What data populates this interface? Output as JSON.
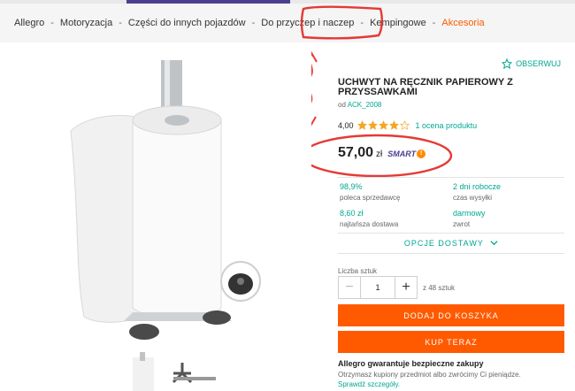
{
  "colors": {
    "accent": "#ff5a00",
    "teal": "#00a790",
    "brand": "#4a3f8f",
    "annotation": "#e53935"
  },
  "breadcrumb": [
    "Allegro",
    "Motoryzacja",
    "Części do innych pojazdów",
    "Do przyczep i naczep",
    "Kempingowe",
    "Akcesoria"
  ],
  "product": {
    "watch_label": "OBSERWUJ",
    "watch_icon": "star-outline-icon",
    "title": "UCHWYT NA RĘCZNIK PAPIEROWY Z PRZYSSAWKAMI",
    "seller_prefix": "od",
    "seller": "ACK_2008",
    "rating_value": "4,00",
    "stars_filled": 4,
    "stars_total": 5,
    "reviews": "1 ocena produktu",
    "price_amount": "57,00",
    "price_currency": "zł",
    "smart_label": "SMART",
    "smart_badge": "!"
  },
  "stats": [
    {
      "value": "98,9%",
      "label": "poleca sprzedawcę"
    },
    {
      "value": "2 dni robocze",
      "label": "czas wysyłki"
    },
    {
      "value": "8,60 zł",
      "label": "najtańsza dostawa"
    },
    {
      "value": "darmowy",
      "label": "zwrot"
    }
  ],
  "delivery_options": "OPCJE DOSTAWY",
  "quantity": {
    "label": "Liczba sztuk",
    "value": "1",
    "of": "z 48 sztuk"
  },
  "buttons": {
    "add_to_cart": "DODAJ DO KOSZYKA",
    "buy_now": "KUP TERAZ"
  },
  "guarantee": {
    "title": "Allegro gwarantuje bezpieczne zakupy",
    "text": "Otrzymasz kupiony przedmiot albo zwrócimy Ci pieniądze.",
    "link": "Sprawdź szczegóły."
  }
}
